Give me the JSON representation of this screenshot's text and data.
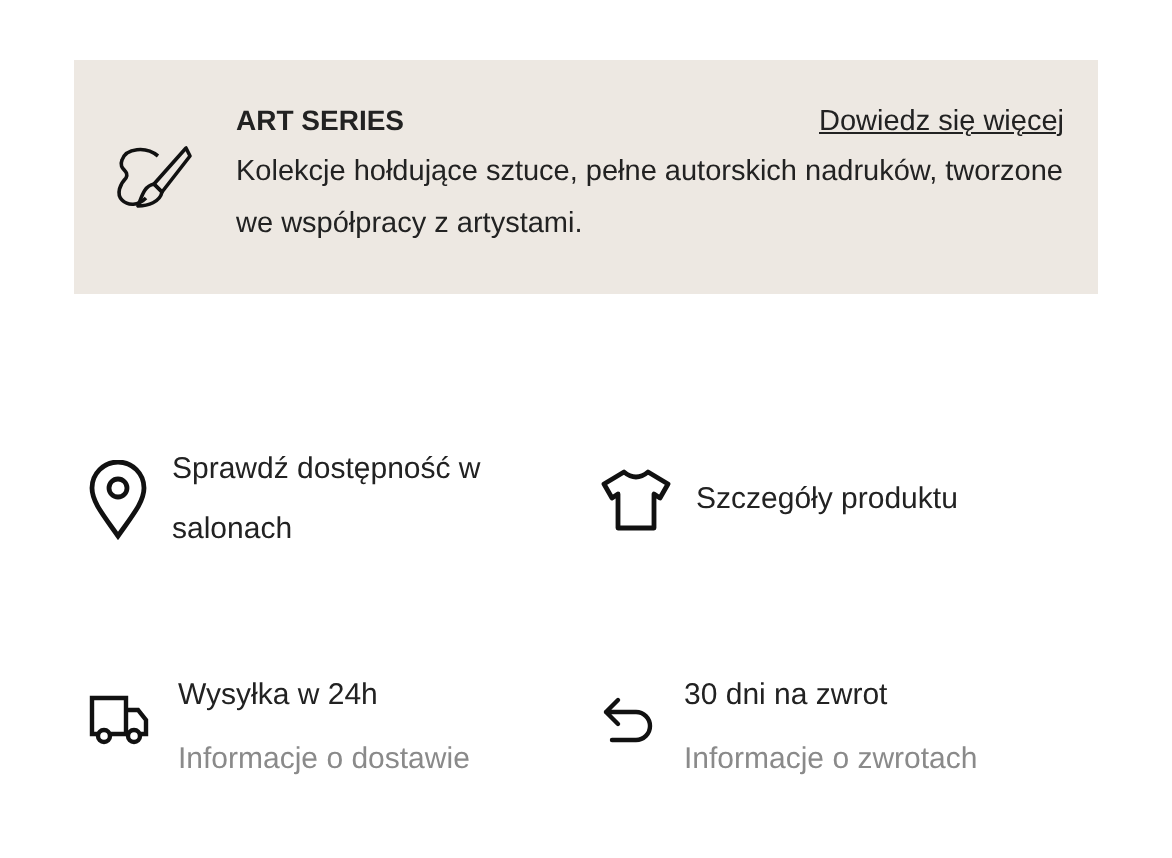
{
  "banner": {
    "title": "ART SERIES",
    "link": "Dowiedz się więcej",
    "text": "Kolekcje hołdujące sztuce, pełne autorskich nadruków, tworzone we współpracy z artystami."
  },
  "features": [
    {
      "kind": "pin",
      "title": "Sprawdź dostępność w salonach"
    },
    {
      "kind": "shirt",
      "title": "Szczegóły produktu"
    },
    {
      "kind": "truck",
      "title": "Wysyłka w 24h",
      "link": "Informacje o dostawie"
    },
    {
      "kind": "return",
      "title": "30 dni na zwrot",
      "link": "Informacje o zwrotach"
    }
  ]
}
